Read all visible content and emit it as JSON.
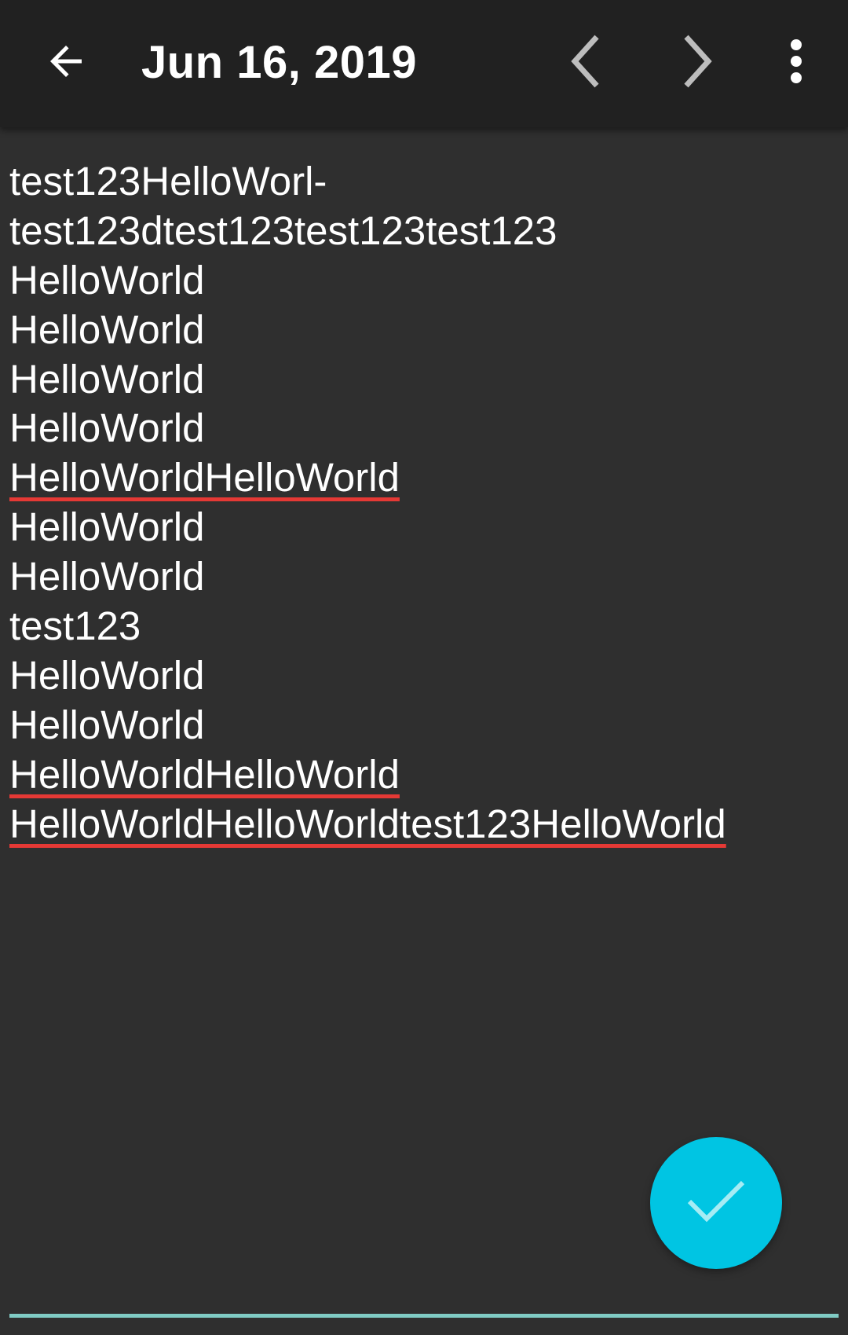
{
  "toolbar": {
    "title": "Jun 16, 2019",
    "icons": {
      "back": "arrow-left-icon",
      "previous": "chevron-left-icon",
      "next": "chevron-right-icon",
      "more": "more-vertical-icon"
    }
  },
  "editor": {
    "lines": [
      {
        "text": "test123HelloWorl-",
        "misspelled": false
      },
      {
        "text": "test123dtest123test123test123",
        "misspelled": false
      },
      {
        "text": "HelloWorld",
        "misspelled": false
      },
      {
        "text": "HelloWorld",
        "misspelled": false
      },
      {
        "text": "HelloWorld",
        "misspelled": false
      },
      {
        "text": "HelloWorld",
        "misspelled": false
      },
      {
        "text": "HelloWorldHelloWorld",
        "misspelled": true
      },
      {
        "text": "HelloWorld",
        "misspelled": false
      },
      {
        "text": "HelloWorld",
        "misspelled": false
      },
      {
        "text": "test123",
        "misspelled": false
      },
      {
        "text": "HelloWorld",
        "misspelled": false
      },
      {
        "text": "HelloWorld",
        "misspelled": false
      },
      {
        "text": "HelloWorldHelloWorld",
        "misspelled": true
      },
      {
        "text": "HelloWorldHelloWorldtest123HelloWorld",
        "misspelled": true
      }
    ]
  },
  "fab": {
    "icon": "check-icon"
  },
  "colors": {
    "toolbar_bg": "#212121",
    "background": "#2f2f2f",
    "accent": "#00c5e3",
    "spellcheck_underline": "#e53935",
    "input_underline": "#80cbc4"
  }
}
